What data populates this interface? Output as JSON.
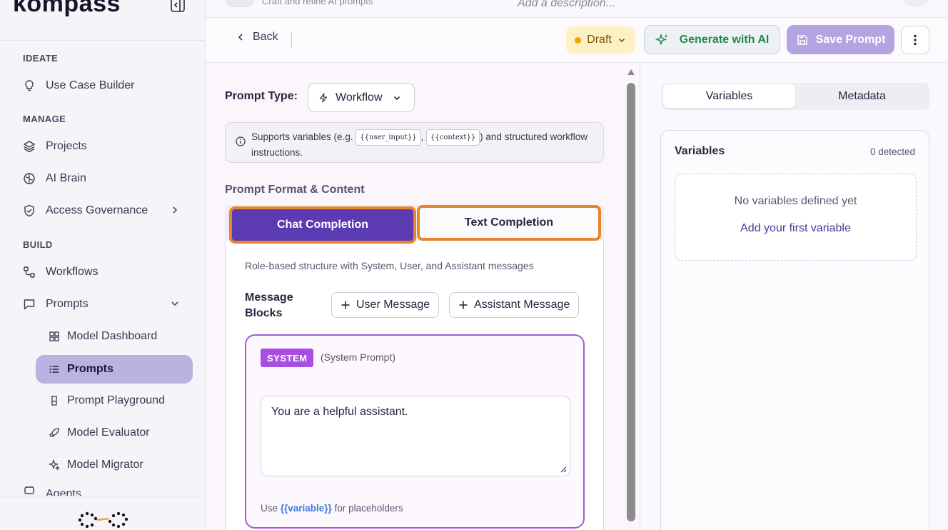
{
  "brand": {
    "name": "kompass"
  },
  "topbar": {
    "subtitle": "Craft and refine AI prompts",
    "description_placeholder": "Add a description..."
  },
  "sidebar": {
    "sections": [
      {
        "label": "IDEATE"
      },
      {
        "label": "MANAGE"
      },
      {
        "label": "BUILD"
      }
    ],
    "items": {
      "use_case_builder": "Use Case Builder",
      "projects": "Projects",
      "ai_brain": "AI Brain",
      "access_governance": "Access Governance",
      "workflows": "Workflows",
      "prompts": "Prompts",
      "agents": "Agents"
    },
    "sub_items": {
      "model_dashboard": "Model Dashboard",
      "prompts": "Prompts",
      "prompt_playground": "Prompt Playground",
      "model_evaluator": "Model Evaluator",
      "model_migrator": "Model Migrator"
    }
  },
  "toolbar": {
    "back_label": "Back",
    "status_label": "Draft",
    "generate_label": "Generate with AI",
    "save_label": "Save Prompt",
    "colors": {
      "status_dot": "#f2a400",
      "generate_text": "#1f8a4c",
      "save_bg": "#b3a5e2"
    }
  },
  "editor": {
    "prompt_type_label": "Prompt Type:",
    "prompt_type_value": "Workflow",
    "info": {
      "before": "Supports variables (e.g. ",
      "chip1": "{{user_input}}",
      "mid": ", ",
      "chip2": "{{context}}",
      "after": ") and structured workflow instructions."
    },
    "format_label": "Prompt Format & Content",
    "tabs": {
      "chat": "Chat Completion",
      "text": "Text Completion",
      "active": "chat"
    },
    "role_description": "Role-based structure with System, User, and Assistant messages",
    "message_blocks_label": "Message Blocks",
    "add_user_label": "User Message",
    "add_assistant_label": "Assistant Message",
    "system": {
      "tag": "SYSTEM",
      "subtitle": "(System Prompt)",
      "content": "You are a helpful assistant.",
      "hint_before": "Use ",
      "hint_var": "{{variable}}",
      "hint_after": " for placeholders"
    },
    "colors": {
      "chat_tab_bg": "#5b3ab3",
      "highlight": "#e8842c",
      "system_tag": "#a84ee0"
    }
  },
  "right_panel": {
    "tabs": {
      "variables": "Variables",
      "metadata": "Metadata",
      "active": "variables"
    },
    "variables": {
      "title": "Variables",
      "count": "0 detected",
      "empty_text": "No variables defined yet",
      "add_first": "Add your first variable"
    }
  }
}
